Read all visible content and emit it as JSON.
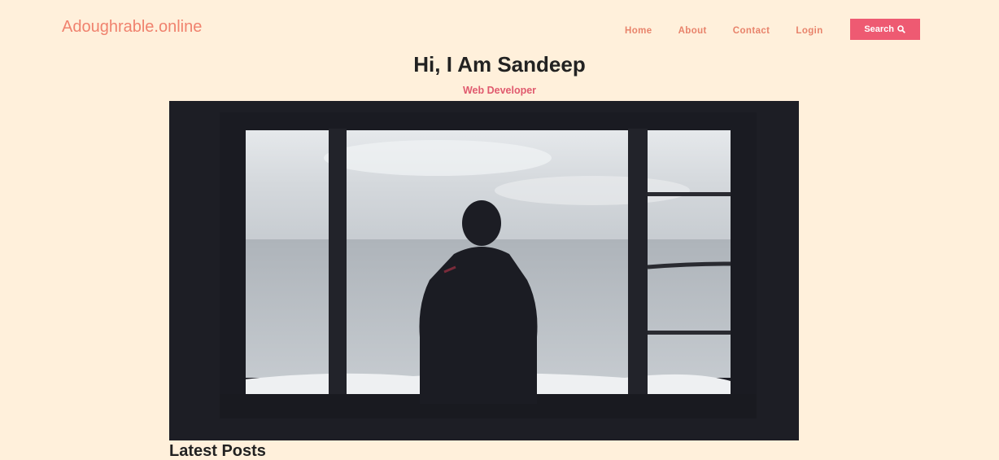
{
  "header": {
    "brand": "Adoughrable.online",
    "nav": [
      "Home",
      "About",
      "Contact",
      "Login"
    ],
    "search_label": "Search",
    "search_icon": "magnifier-icon"
  },
  "hero": {
    "title": "Hi, I Am Sandeep",
    "subtitle": "Web Developer"
  },
  "sections": {
    "latest_posts": "Latest Posts"
  },
  "colors": {
    "background": "#fff0db",
    "brand": "#f0826e",
    "accent": "#ee5a72"
  }
}
